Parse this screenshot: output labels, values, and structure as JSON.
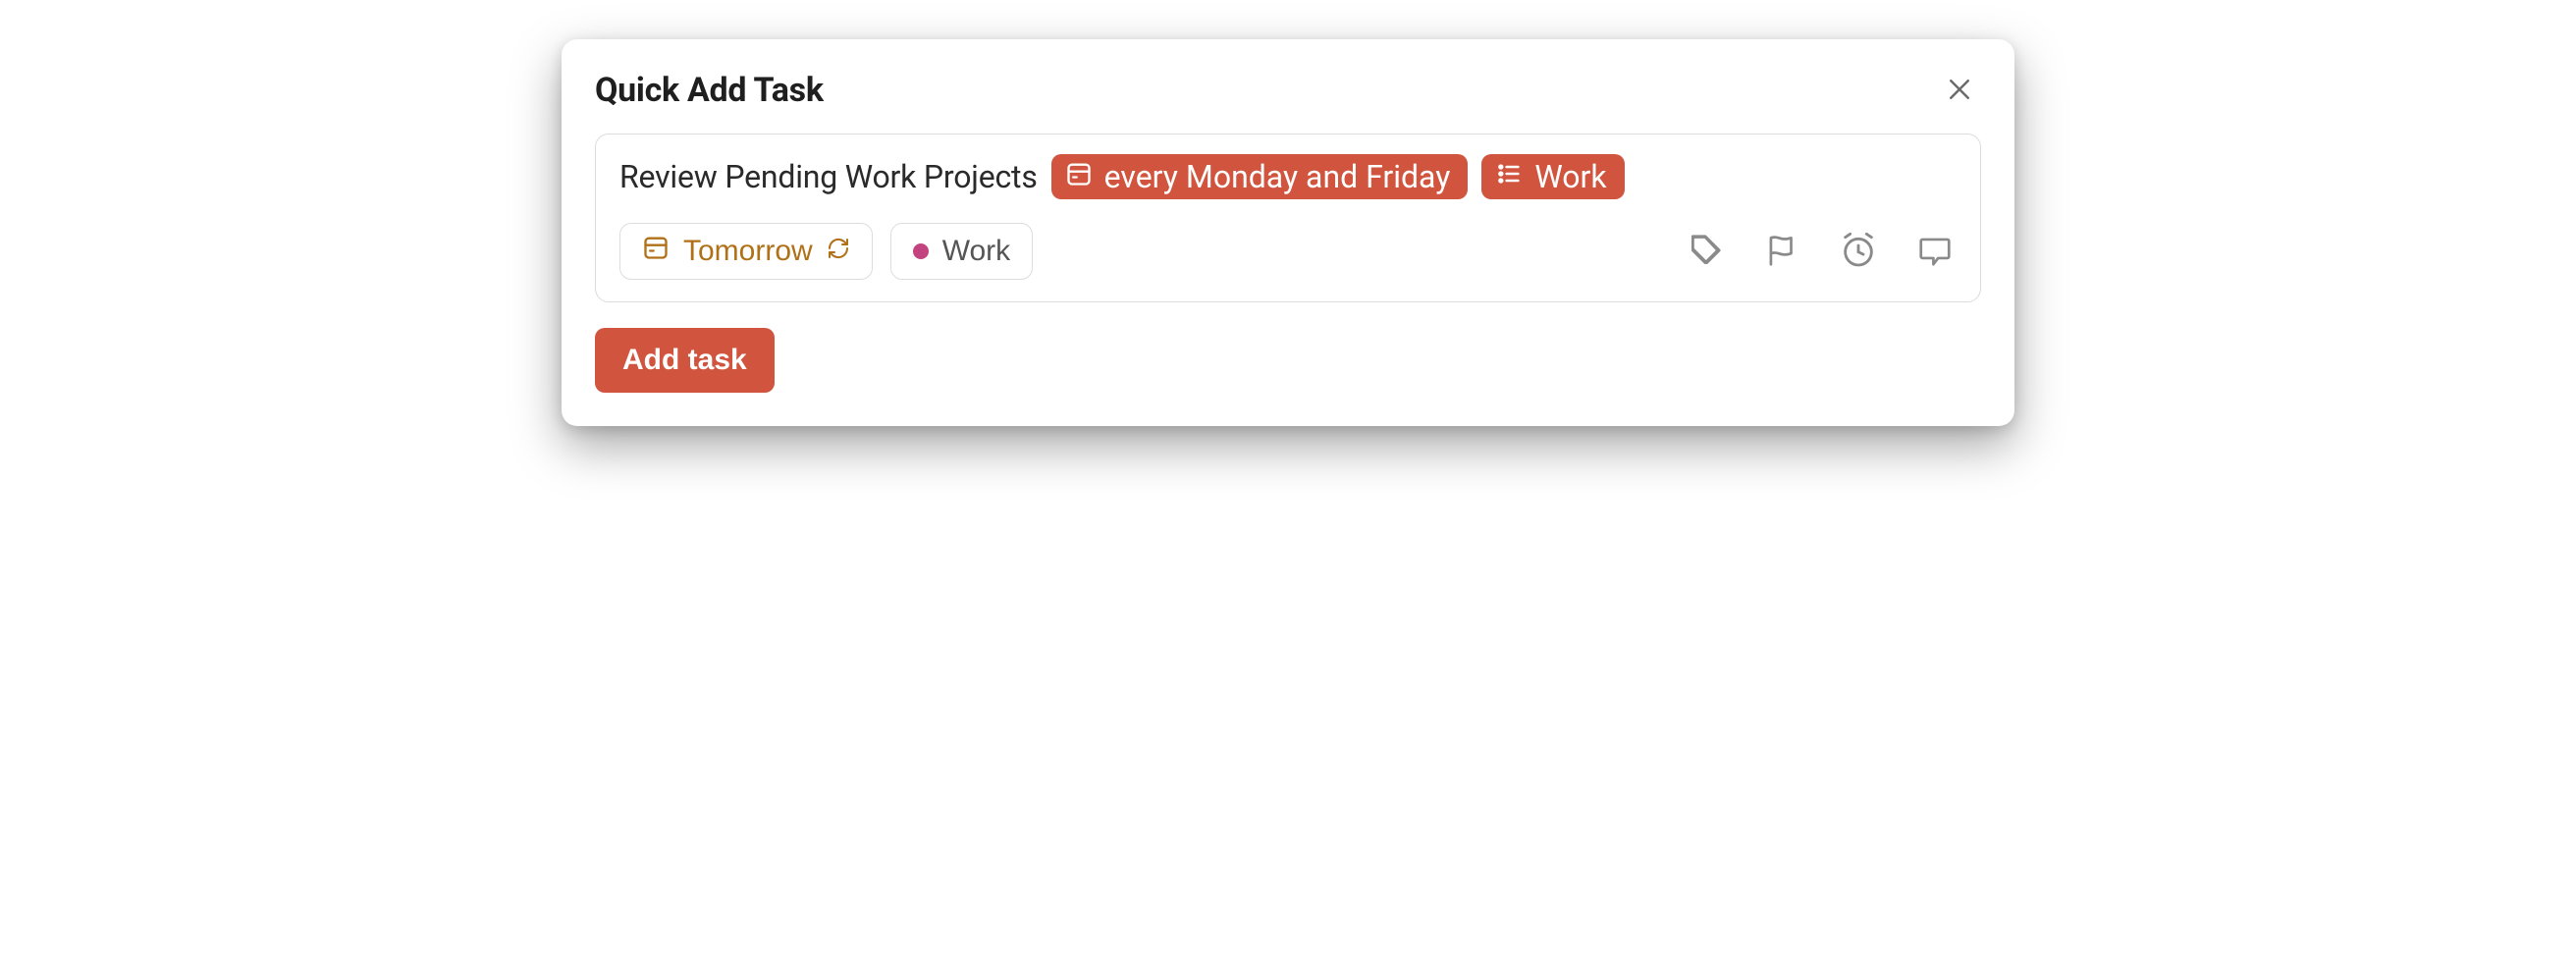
{
  "dialog": {
    "title": "Quick Add Task"
  },
  "task": {
    "text": "Review Pending Work Projects",
    "schedule_pill": "every Monday and Friday",
    "project_pill": "Work"
  },
  "controls": {
    "date_chip": "Tomorrow",
    "project_chip": "Work"
  },
  "actions": {
    "submit": "Add task"
  },
  "colors": {
    "accent": "#d1543e",
    "date_accent": "#b07018",
    "project_dot": "#c2437f"
  }
}
